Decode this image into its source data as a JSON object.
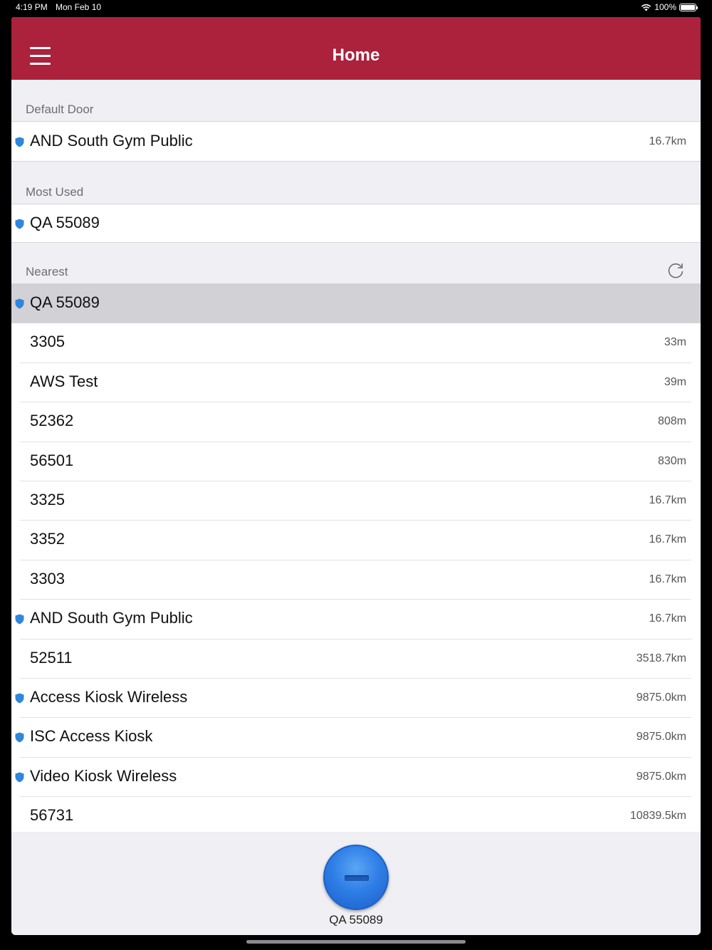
{
  "status_bar": {
    "time": "4:19 PM",
    "date": "Mon Feb 10",
    "battery": "100%"
  },
  "nav": {
    "title": "Home"
  },
  "sections": {
    "default_door": {
      "header": "Default Door",
      "items": [
        {
          "label": "AND  South Gym Public",
          "distance": "16.7km",
          "shield": true
        }
      ]
    },
    "most_used": {
      "header": "Most Used",
      "items": [
        {
          "label": "QA 55089",
          "distance": "",
          "shield": true
        }
      ]
    },
    "nearest": {
      "header": "Nearest",
      "items": [
        {
          "label": "QA 55089",
          "distance": "",
          "shield": true,
          "selected": true
        },
        {
          "label": "3305",
          "distance": "33m",
          "shield": false
        },
        {
          "label": "AWS Test",
          "distance": "39m",
          "shield": false
        },
        {
          "label": "52362",
          "distance": "808m",
          "shield": false
        },
        {
          "label": "56501",
          "distance": "830m",
          "shield": false
        },
        {
          "label": "3325",
          "distance": "16.7km",
          "shield": false
        },
        {
          "label": "3352",
          "distance": "16.7km",
          "shield": false
        },
        {
          "label": "3303",
          "distance": "16.7km",
          "shield": false
        },
        {
          "label": "AND  South Gym Public",
          "distance": "16.7km",
          "shield": true
        },
        {
          "label": "52511",
          "distance": "3518.7km",
          "shield": false
        },
        {
          "label": "Access Kiosk Wireless",
          "distance": "9875.0km",
          "shield": true
        },
        {
          "label": "ISC Access Kiosk",
          "distance": "9875.0km",
          "shield": true
        },
        {
          "label": "Video Kiosk Wireless",
          "distance": "9875.0km",
          "shield": true
        },
        {
          "label": "56731",
          "distance": "10839.5km",
          "shield": false
        }
      ]
    }
  },
  "bottom": {
    "selected_door": "QA 55089"
  },
  "colors": {
    "nav_bg": "#ac213b",
    "shield": "#2f86db",
    "button": "#2f7fe6"
  }
}
